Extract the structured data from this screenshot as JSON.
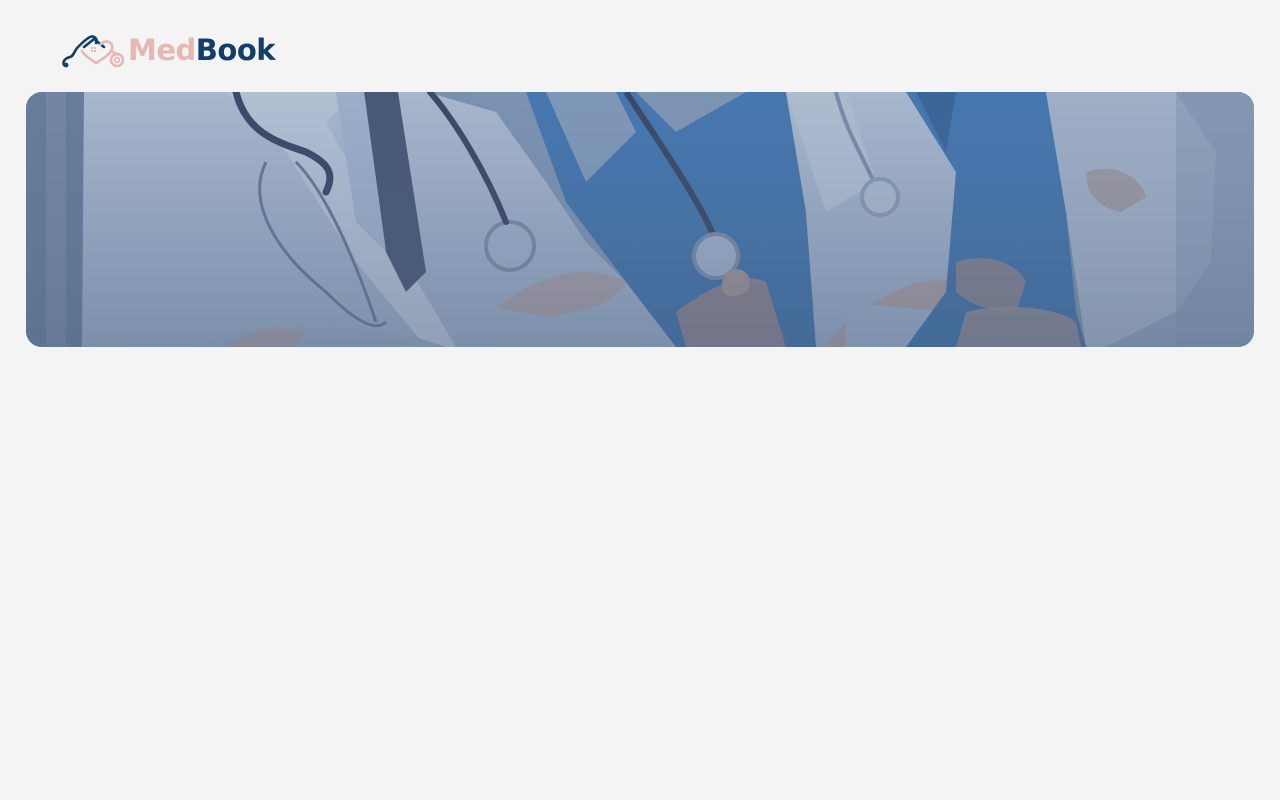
{
  "header": {
    "logo": {
      "word_part_1": "Med",
      "word_part_2": "Book",
      "icon": "stethoscope-heart-icon",
      "colors": {
        "accent_pink": "#e8b7b3",
        "brand_navy": "#123f69"
      }
    }
  },
  "hero": {
    "image": "doctors-team-photo",
    "overlay_color": "#5f7aa3",
    "colors": {
      "scrubs_blue": "#3f7fc2",
      "coat_white": "#cfd8e6"
    }
  },
  "page": {
    "background": "#f4f4f4"
  }
}
